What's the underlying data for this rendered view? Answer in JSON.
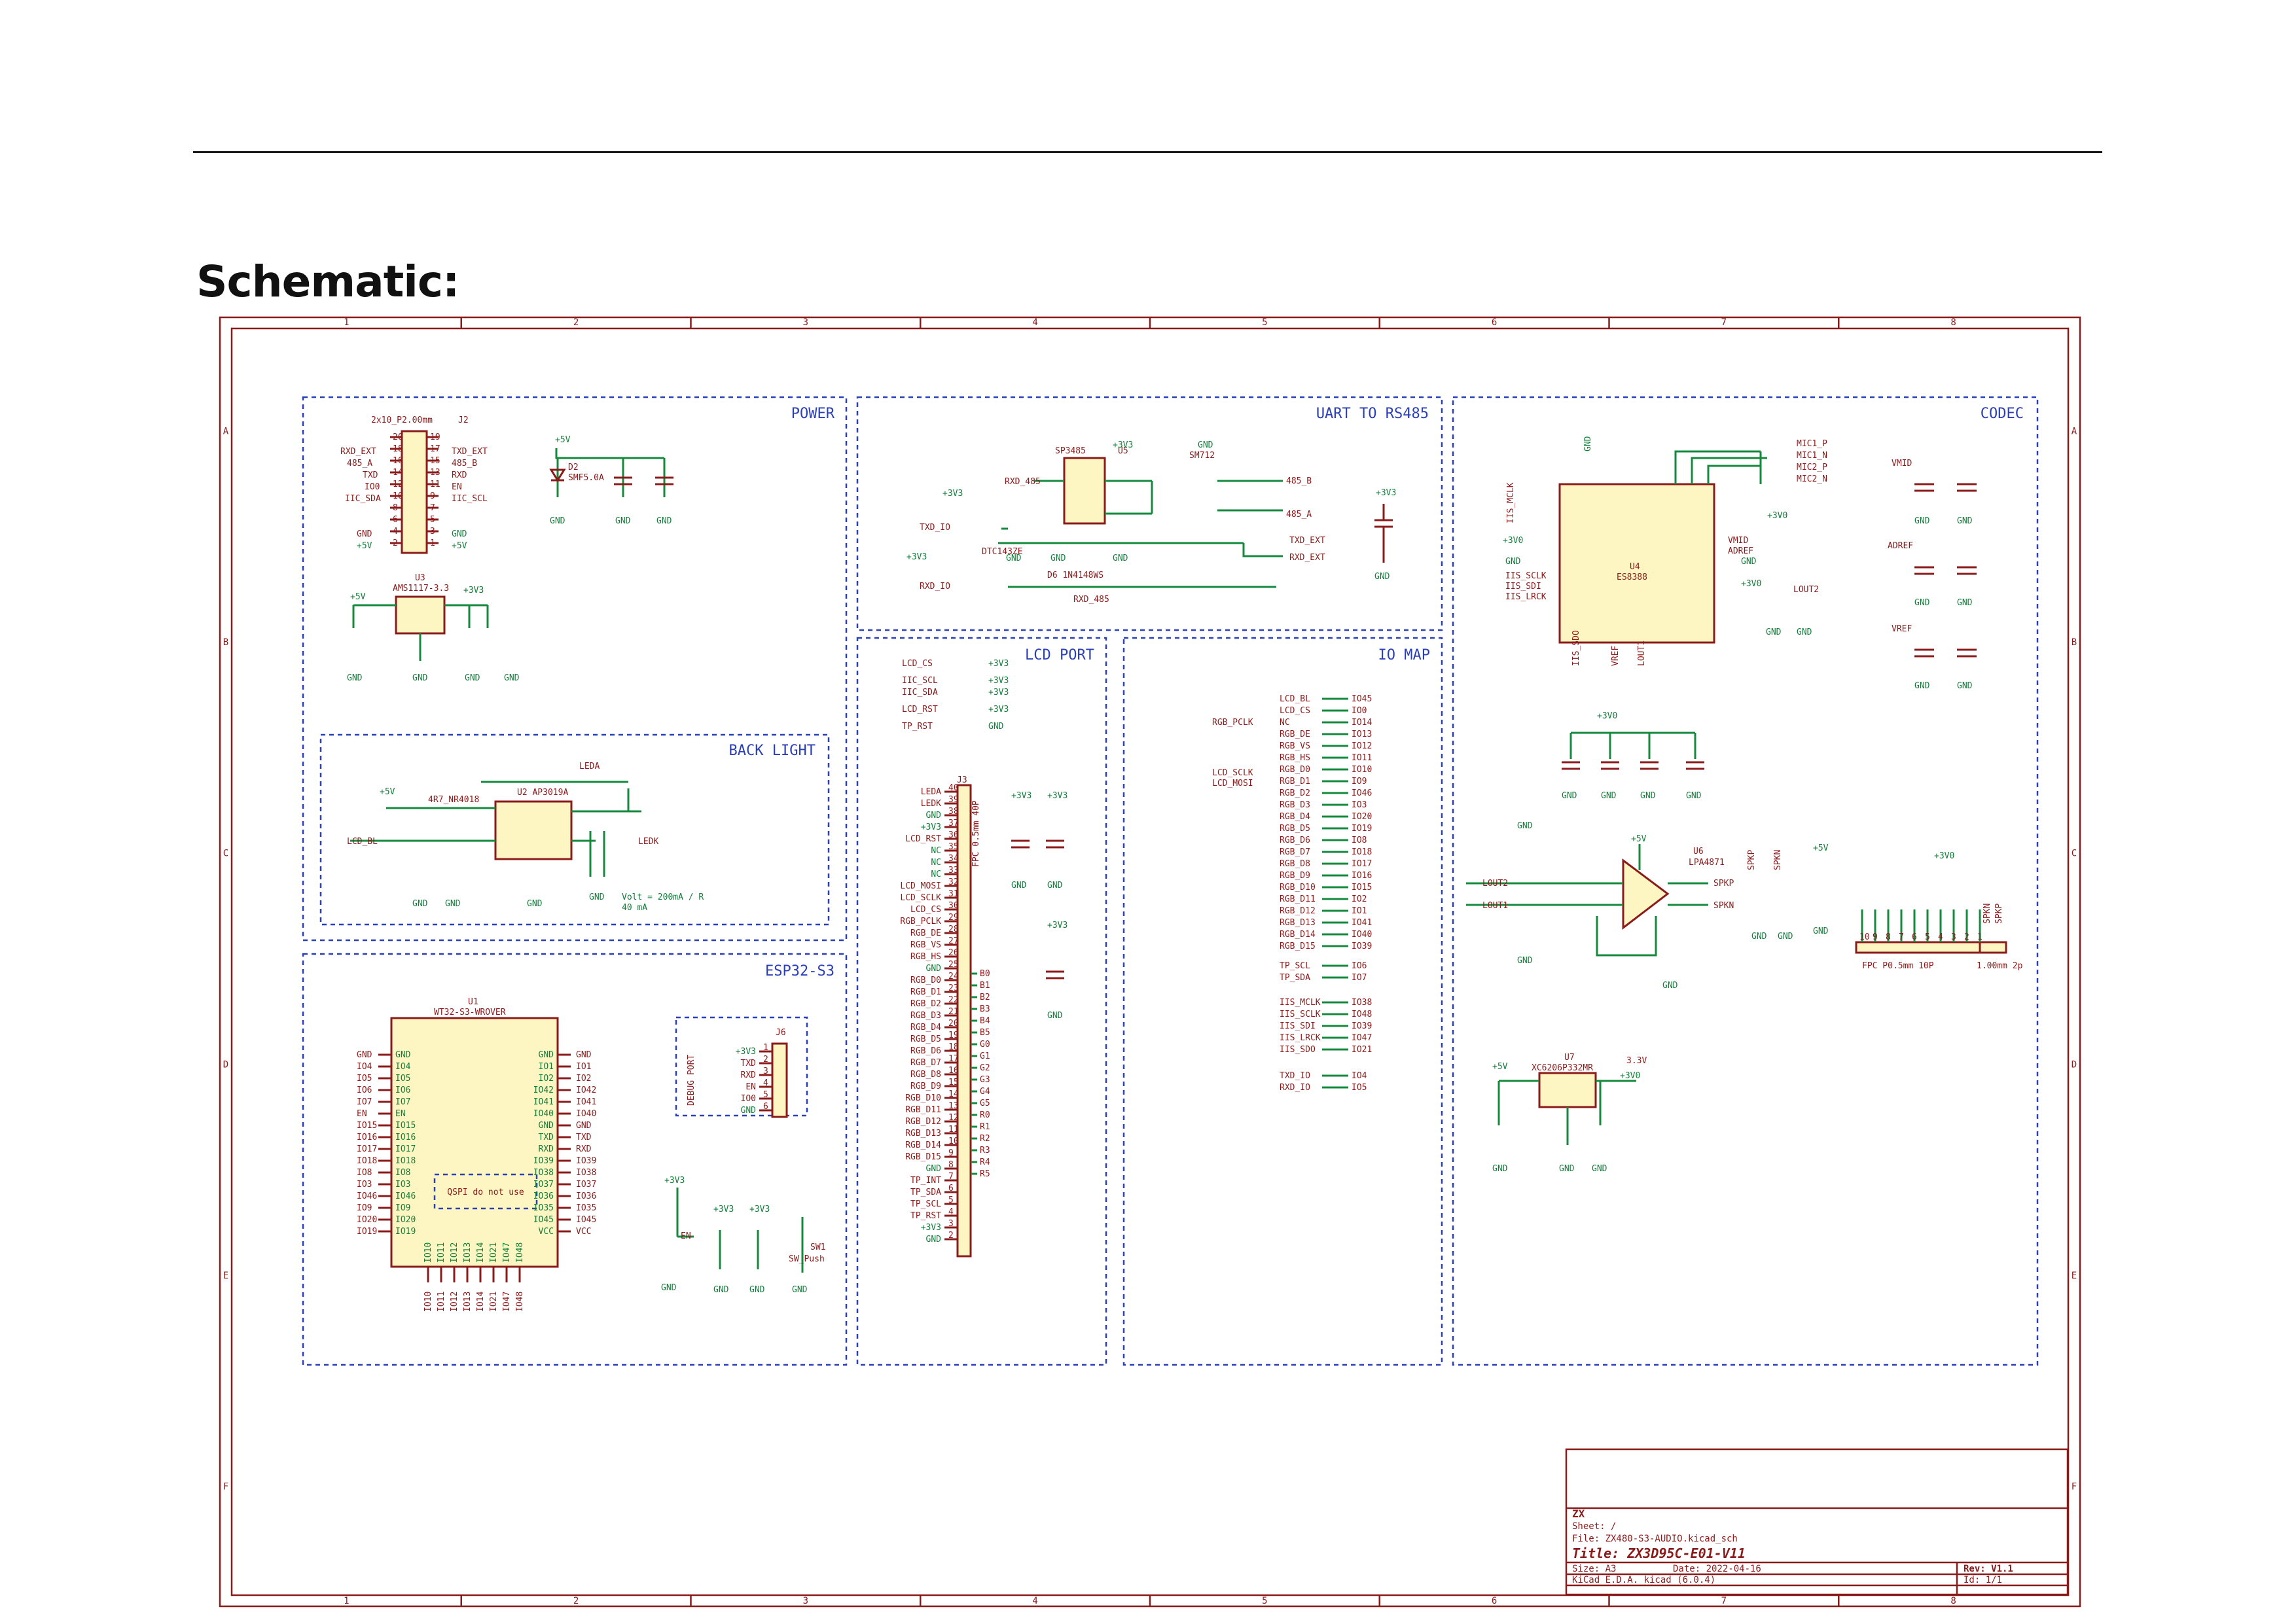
{
  "heading": "Schematic:",
  "blocks": {
    "power": "POWER",
    "uart": "UART TO RS485",
    "codec": "CODEC",
    "lcd_port": "LCD PORT",
    "io_map": "IO MAP",
    "back_light": "BACK LIGHT",
    "esp32": "ESP32-S3",
    "debug": "DEBUG PORT",
    "qspi": "QSPI do not use"
  },
  "grid": {
    "columns": [
      "1",
      "2",
      "3",
      "4",
      "5",
      "6",
      "7",
      "8"
    ],
    "rows": [
      "A",
      "B",
      "C",
      "D",
      "E",
      "F"
    ]
  },
  "parts": {
    "j2": "J2",
    "j2_value": "2x10_P2.00mm",
    "u3": "U3",
    "u3_value": "AMS1117-3.3",
    "d2": "D2",
    "d2_value": "SMF5.0A",
    "u5": "U5",
    "u5_value": "SP3485",
    "q3_value": "DTC143ZE",
    "d6_value": "D6 1N4148WS",
    "sm712": "SM712",
    "u4": "U4",
    "u4_value": "ES8388",
    "u6": "U6",
    "u6_value": "LPA4871",
    "u7": "U7",
    "u7_value": "XC6206P332MR",
    "u7_out": "3.3V",
    "u1": "U1",
    "u1_value": "WT32-S3-WROVER",
    "u2_value": "U2 AP3019A",
    "l1_value": "4R7_NR4018",
    "j3": "J3",
    "j3_value": "FPC 0.5mm 40P",
    "j4_value": "FPC P0.5mm 10P",
    "j5_value": "1.00mm 2p",
    "j6": "J6",
    "sw1": "SW1",
    "sw1_value": "SW_Push",
    "note_volt": "Volt = 200mA / R",
    "note_ma": "40 mA"
  },
  "nets": {
    "v5": "+5V",
    "v33": "+3V3",
    "v30": "+3V0",
    "gnd": "GND",
    "rxd_ext": "RXD_EXT",
    "txd_ext": "TXD_EXT",
    "a485": "485_A",
    "b485": "485_B",
    "txd": "TXD",
    "rxd": "RXD",
    "io0": "IO0",
    "en": "EN",
    "iic_sda": "IIC_SDA",
    "iic_scl": "IIC_SCL",
    "txd_io": "TXD_IO",
    "rxd_io": "RXD_IO",
    "rxd_485": "RXD_485",
    "lcd_bl": "LCD_BL",
    "ledk": "LEDK",
    "leda": "LEDA",
    "vmid": "VMID",
    "adref": "ADREF",
    "vref": "VREF",
    "lout1": "LOUT1",
    "lout2": "LOUT2",
    "spkp": "SPKP",
    "spkn": "SPKN",
    "mic1p": "MIC1_P",
    "mic1n": "MIC1_N",
    "mic2p": "MIC2_P",
    "mic2n": "MIC2_N",
    "iis_mclk": "IIS_MCLK",
    "iis_sclk": "IIS_SCLK",
    "iis_sdi": "IIS_SDI",
    "iis_sdo": "IIS_SDO",
    "iis_lrck": "IIS_LRCK",
    "lcd_cs": "LCD_CS",
    "lcd_rst": "LCD_RST",
    "lcd_sclk": "LCD_SCLK",
    "lcd_mosi": "LCD_MOSI",
    "tp_rst": "TP_RST",
    "tp_int": "TP_INT",
    "tp_scl": "TP_SCL",
    "tp_sda": "TP_SDA",
    "rgb_pclk": "RGB_PCLK",
    "rgb_de": "RGB_DE",
    "rgb_vs": "RGB_VS",
    "rgb_hs": "RGB_HS"
  },
  "io_map": {
    "left": [
      "LCD_BL",
      "LCD_CS",
      "NC",
      "RGB_DE",
      "RGB_VS",
      "RGB_HS",
      "RGB_D0",
      "RGB_D1",
      "RGB_D2",
      "RGB_D3",
      "RGB_D4",
      "RGB_D5",
      "RGB_D6",
      "RGB_D7",
      "RGB_D8",
      "RGB_D9",
      "RGB_D10",
      "RGB_D11",
      "RGB_D12",
      "RGB_D13",
      "RGB_D14",
      "RGB_D15"
    ],
    "right": [
      "IO45",
      "IO0",
      "IO14",
      "IO13",
      "IO12",
      "IO11",
      "IO10",
      "IO9",
      "IO46",
      "IO3",
      "IO20",
      "IO19",
      "IO8",
      "IO18",
      "IO17",
      "IO16",
      "IO15",
      "IO2",
      "IO1",
      "IO41",
      "IO40",
      "IO39"
    ],
    "tp_left": [
      "TP_SCL",
      "TP_SDA"
    ],
    "tp_right": [
      "IO6",
      "IO7"
    ],
    "iis_left": [
      "IIS_MCLK",
      "IIS_SCLK",
      "IIS_SDI",
      "IIS_LRCK",
      "IIS_SDO"
    ],
    "iis_right": [
      "IO38",
      "IO48",
      "IO39",
      "IO47",
      "IO21"
    ],
    "uart_left": [
      "TXD_IO",
      "RXD_IO"
    ],
    "uart_right": [
      "IO4",
      "IO5"
    ]
  },
  "lcd_pins": [
    "LEDA",
    "LEDK",
    "GND",
    "+3V3",
    "LCD_RST",
    "NC",
    "NC",
    "NC",
    "LCD_MOSI",
    "LCD_SCLK",
    "LCD_CS",
    "RGB_PCLK",
    "RGB_DE",
    "RGB_VS",
    "RGB_HS",
    "GND",
    "RGB_D0",
    "RGB_D1",
    "RGB_D2",
    "RGB_D3",
    "RGB_D4",
    "RGB_D5",
    "RGB_D6",
    "RGB_D7",
    "RGB_D8",
    "RGB_D9",
    "RGB_D10",
    "RGB_D11",
    "RGB_D12",
    "RGB_D13",
    "RGB_D14",
    "RGB_D15",
    "GND",
    "TP_INT",
    "TP_SDA",
    "TP_SCL",
    "TP_RST",
    "+3V3",
    "GND"
  ],
  "esp_left": [
    "GND",
    "IO4",
    "IO5",
    "IO6",
    "IO7",
    "EN",
    "IO15",
    "IO16",
    "IO17",
    "IO18",
    "IO8",
    "IO3",
    "IO46",
    "IO9",
    "IO20",
    "IO19"
  ],
  "esp_right": [
    "GND",
    "IO1",
    "IO2",
    "IO42",
    "IO41",
    "IO40",
    "GND",
    "TXD",
    "RXD",
    "IO39",
    "IO38",
    "IO37",
    "IO36",
    "IO35",
    "IO45",
    "VCC"
  ],
  "esp_bottom": [
    "IO10",
    "IO11",
    "IO12",
    "IO13",
    "IO14",
    "IO21",
    "IO47",
    "IO48"
  ],
  "title_block": {
    "company": "ZX",
    "sheet": "Sheet: /",
    "file": "File: ZX480-S3-AUDIO.kicad_sch",
    "title": "Title: ZX3D95C-E01-V11",
    "size": "Size: A3",
    "date": "Date: 2022-04-16",
    "rev": "Rev: V1.1",
    "kicad": "KiCad E.D.A.  kicad (6.0.4)",
    "id": "Id: 1/1"
  }
}
